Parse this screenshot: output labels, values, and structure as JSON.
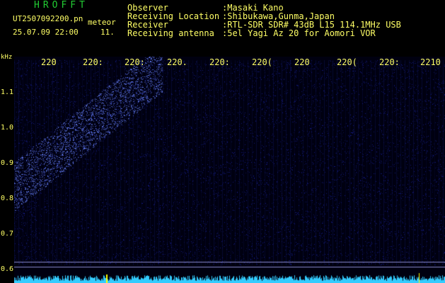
{
  "header": {
    "app_title": "HROFFT",
    "file_name": "UT2507092200.pn",
    "mode": "meteor",
    "datetime": "25.07.09 22:00",
    "counter": "11."
  },
  "station": [
    {
      "label": "Observer",
      "value": ":Masaki Kano"
    },
    {
      "label": "Receiving Location",
      "value": ":Shibukawa,Gunma,Japan"
    },
    {
      "label": "Receiver",
      "value": ":RTL-SDR SDR# 43dB L15 114.1MHz USB"
    },
    {
      "label": "Receiving antenna",
      "value": ":5el Yagi Az 20 for Aomori VOR"
    }
  ],
  "axis": {
    "unit": "kHz",
    "y_ticks": [
      "1.1",
      "1.0",
      "0.9",
      "0.8",
      "0.7",
      "0.6"
    ],
    "x_ticks": [
      "220",
      "220:",
      "220:",
      "220.",
      "220:",
      "220(",
      "220",
      "220(",
      "220:",
      "2210"
    ]
  },
  "colors": {
    "background": "#000000",
    "label_yellow": "#ffff66",
    "title_green": "#22cc33",
    "noise_blue": "#1a2299",
    "echo_blue": "#6688ff",
    "baseline_cyan": "#33ccff"
  }
}
